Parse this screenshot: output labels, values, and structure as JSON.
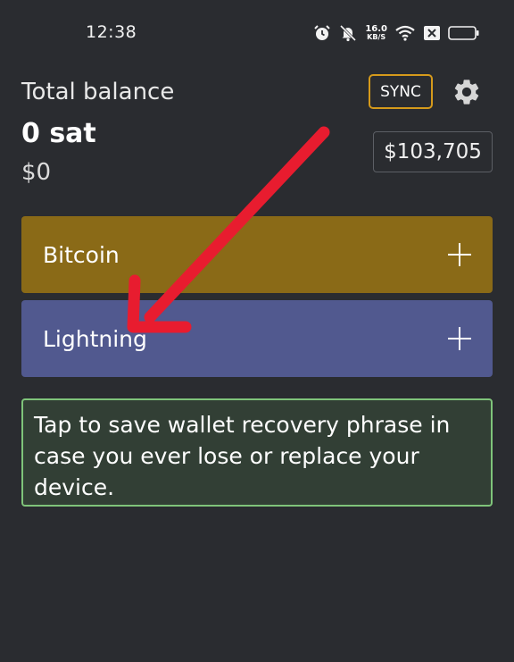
{
  "status_bar": {
    "time": "12:38",
    "net_speed_value": "16.0",
    "net_speed_unit": "KB/S",
    "icons": [
      "alarm-icon",
      "silent-mode-icon",
      "wifi-icon",
      "sim-blocked-icon",
      "battery-icon"
    ]
  },
  "balance": {
    "label": "Total balance",
    "sat": "0 sat",
    "fiat": "$0"
  },
  "toolbar": {
    "sync_label": "SYNC",
    "settings_icon": "gear-icon"
  },
  "price": "$103,705",
  "wallets": [
    {
      "label": "Bitcoin",
      "color": "#8a6a17",
      "icon": "plus-icon"
    },
    {
      "label": "Lightning",
      "color": "#51598f",
      "icon": "plus-icon"
    }
  ],
  "backup_notice": {
    "text": "Tap to save wallet recovery phrase in case you ever lose or replace your device.",
    "border_color": "#7fc47a"
  },
  "annotation": {
    "color": "#e81c2f",
    "icon": "arrow-icon"
  },
  "colors": {
    "background": "#2a2c30",
    "sync_border": "#d59a1b"
  }
}
